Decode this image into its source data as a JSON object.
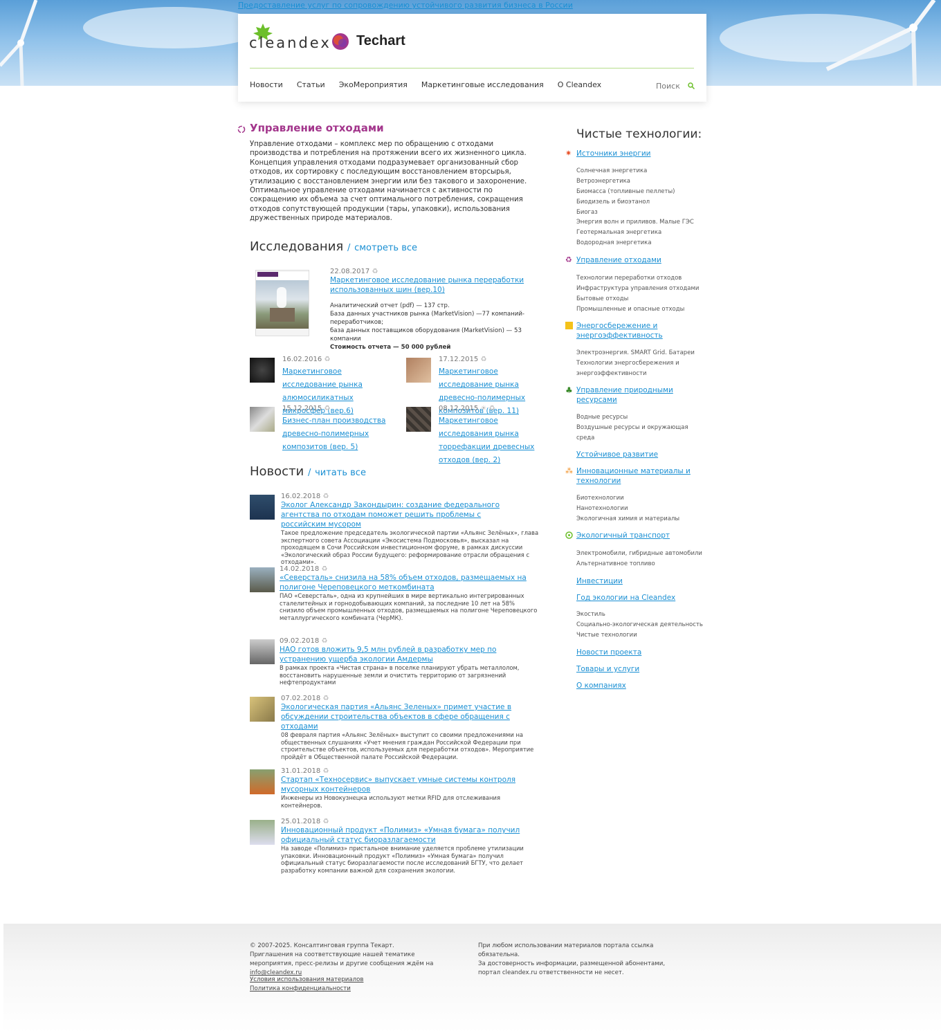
{
  "banner": {
    "alt_text": "Предоставление услуг по сопровождению устойчивого развития бизнеса в России"
  },
  "header": {
    "logo_cleandex": "cleandex",
    "logo_techart": "Techart",
    "nav": [
      "Новости",
      "Статьи",
      "ЭкоМероприятия",
      "Маркетинговые исследования",
      "О Cleandex"
    ],
    "search_label": "Поиск"
  },
  "main": {
    "title": "Управление отходами",
    "intro": "Управление отходами – комплекс мер по обращению с отходами производства и потребления на протяжении всего их жизненного цикла. Концепция управления отходами подразумевает организованный сбор отходов, их сортировку с последующим восстановлением вторсырья, утилизацию с восстановлением энергии или без такового и захоронение. Оптимальное управление отходами начинается с активности по сокращению их объема за счет оптимального потребления, сокращения отходов сопутствующей продукции (тары, упаковки), использования дружественных природе материалов.",
    "research_heading": "Исследования",
    "research_sep": "/",
    "research_all": "смотреть все",
    "featured": {
      "date": "22.08.2017",
      "title": "Маркетинговое исследование рынка переработки использованных шин (вер.10)",
      "line1": "Аналитический отчет (pdf) — 137 стр.",
      "line2": "База данных участников рынка (MarketVision) —77 компаний-переработчиков;",
      "line3": "база данных поставщиков оборудования (MarketVision) — 53 компании",
      "price": "Стоимость отчета — 50 000 рублей"
    },
    "research_items": [
      {
        "date": "16.02.2016",
        "title": "Маркетинговое исследование рынка алюмосиликатных микросфер (вер.6)"
      },
      {
        "date": "17.12.2015",
        "title": "Маркетинговое исследование рынка древесно-полимерных композитов (вер. 11)"
      },
      {
        "date": "15.12.2015",
        "title": "Бизнес-план производства древесно-полимерных композитов (вер. 5)"
      },
      {
        "date": "08.12.2015",
        "title": "Маркетинговое исследования рынка торрефакции древесных отходов (вер. 2)"
      }
    ],
    "news_heading": "Новости",
    "news_sep": "/",
    "news_all": "читать все",
    "news": [
      {
        "date": "16.02.2018",
        "title": "Эколог Александр Закондырин: создание федерального агентства по отходам поможет решить проблемы с российским мусором",
        "desc": "Такое предложение председатель экологической партии «Альянс Зелёных», глава экспертного совета Ассоциации «Экосистема Подмосковья», высказал на проходящем в Сочи Российском инвестиционном форуме, в рамках дискуссии «Экологический образ России будущего: реформирование отрасли обращения с отходами»."
      },
      {
        "date": "14.02.2018",
        "title": "«Северсталь» снизила на 58% объем отходов, размещаемых на полигоне Череповецкого меткомбината",
        "desc": "ПАО «Северсталь», одна из крупнейших в мире вертикально интегрированных сталелитейных и горнодобывающих компаний, за последние 10 лет на 58% снизило объем промышленных отходов, размещаемых на полигоне Череповецкого металлургического комбината (ЧерМК)."
      },
      {
        "date": "09.02.2018",
        "title": "НАО готов вложить 9,5 млн рублей в разработку мер по устранению ущерба экологии Амдермы",
        "desc": "В рамках проекта «Чистая страна» в поселке планируют убрать металлолом, восстановить нарушенные земли и очистить территорию от загрязнений нефтепродуктами"
      },
      {
        "date": "07.02.2018",
        "title": "Экологическая партия «Альянс Зеленых» примет участие в обсуждении строительства объектов в сфере обращения с отходами",
        "desc": "08 февраля партия «Альянс Зелёных» выступит со своими предложениями на общественных слушаниях «Учет мнения граждан Российской Федерации при строительстве объектов, используемых для переработки отходов». Мероприятие пройдёт в Общественной палате Российской Федерации."
      },
      {
        "date": "31.01.2018",
        "title": "Стартап «Техносервис» выпускает умные системы контроля мусорных контейнеров",
        "desc": "Инженеры из Новокузнецка используют метки RFID для отслеживания контейнеров."
      },
      {
        "date": "25.01.2018",
        "title": "Инновационный продукт «Полимиз» «Умная бумага» получил официальный статус биоразлагаемости",
        "desc": "На заводе «Полимиз» пристальное внимание уделяется проблеме утилизации упаковки. Инновационный продукт «Полимиз» «Умная бумага» получил официальный статус биоразлагаемости после исследований БГТУ, что делает разработку компании важной для сохранения экологии."
      }
    ]
  },
  "sidebar": {
    "heading": "Чистые технологии:",
    "energy_link": "Источники энергии",
    "energy_subs": [
      "Солнечная энергетика",
      "Ветроэнергетика",
      "Биомасса (топливные пеллеты)",
      "Биодизель и биоэтанол",
      "Биогаз",
      "Энергия волн и приливов. Малые ГЭС",
      "Геотермальная энергетика",
      "Водородная энергетика"
    ],
    "waste_link": "Управление отходами",
    "waste_subs": [
      "Технологии переработки отходов",
      "Инфраструктура управления отходами",
      "Бытовые отходы",
      "Промышленные и опасные отходы"
    ],
    "efficiency_link": "Энергосбережение и энергоэффективность",
    "efficiency_subs": [
      "Электроэнергия. SMART Grid. Батареи",
      "Технологии энергосбережения и",
      "энергоэффективности"
    ],
    "resources_link": "Управление природными ресурсами",
    "resources_subs": [
      "Водные ресурсы",
      "Воздушные ресурсы и окружающая",
      "среда"
    ],
    "sustainable_link": "Устойчивое развитие",
    "innov_link": "Инновационные материалы и технологии",
    "innov_subs": [
      "Биотехнологии",
      "Нанотехнологии",
      "Экологичная химия и материалы"
    ],
    "transport_link": "Экологичный транспорт",
    "transport_subs": [
      "Электромобили, гибридные автомобили",
      "Альтернативное топливо"
    ],
    "invest_link": "Инвестиции",
    "year_link": "Год экологии на Cleandex",
    "year_subs": [
      "Экостиль",
      "Социально-экологическая деятельность",
      "Чистые технологии"
    ],
    "project_news_link": "Новости проекта",
    "goods_link": "Товары и услуги",
    "companies_link": "О компаниях"
  },
  "footer": {
    "copy": "© 2007-2025. Консалтинговая группа Текарт.",
    "invite": "Приглашения на соответствующие нашей тематике мероприятия, пресс-релизы и другие сообщения ждём на",
    "email": "info@cleandex.ru",
    "terms": "Условия использования материалов",
    "privacy": "Политика конфиденциальности",
    "notice1": "При любом использовании материалов портала ссылка обязательна.",
    "notice2": "За достоверность информации, размещенной абонентами, портал cleandex.ru ответственности не несет."
  },
  "colors": {
    "accent_link": "#1a8fd3",
    "title_purple": "#a3368c",
    "leaf_green": "#6cbf2a",
    "header_line": "#b5dd8a"
  }
}
